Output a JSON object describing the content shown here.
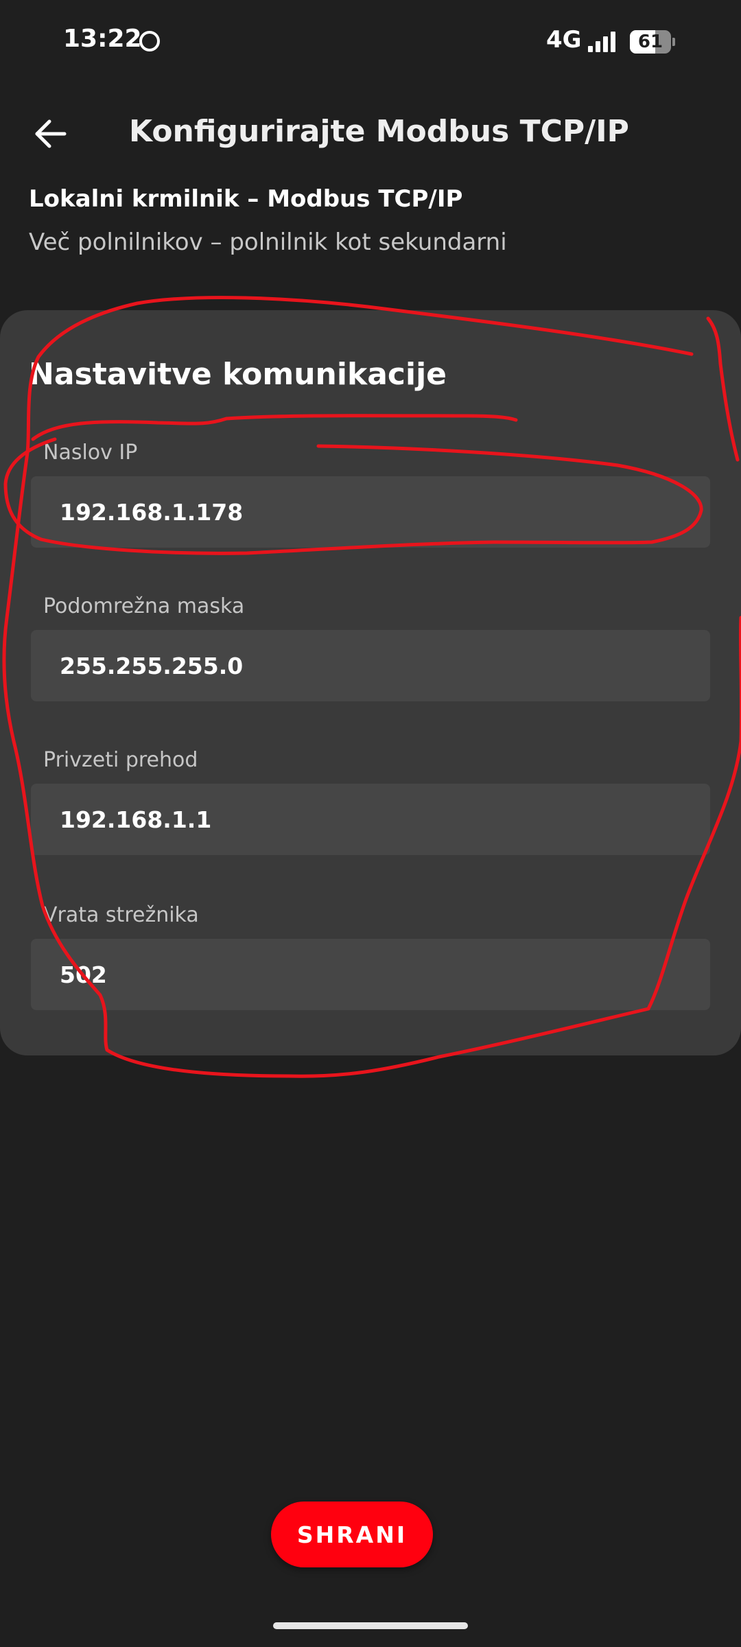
{
  "status_bar": {
    "time": "13:22",
    "network": "4G",
    "battery": "61",
    "battery_level_percent": 61,
    "icons": [
      "circle-notification-icon",
      "signal-icon",
      "battery-icon"
    ]
  },
  "app_bar": {
    "title": "Konfigurirajte Modbus TCP/IP",
    "back_icon": "arrow-left-icon"
  },
  "header": {
    "primary": "Lokalni krmilnik – Modbus TCP/IP",
    "secondary": "Več polnilnikov – polnilnik kot sekundarni"
  },
  "card": {
    "title": "Nastavitve komunikacije",
    "fields": [
      {
        "label": "Naslov IP",
        "value": "192.168.1.178"
      },
      {
        "label": "Podomrežna maska",
        "value": "255.255.255.0"
      },
      {
        "label": "Privzeti prehod",
        "value": "192.168.1.1"
      },
      {
        "label": "Vrata strežnika",
        "value": "502"
      }
    ]
  },
  "actions": {
    "save_label": "SHRANI"
  },
  "colors": {
    "background": "#1f1f1f",
    "card": "#3a3a3a",
    "input": "#464646",
    "accent": "#ff000f",
    "annotation": "#e8141c"
  }
}
